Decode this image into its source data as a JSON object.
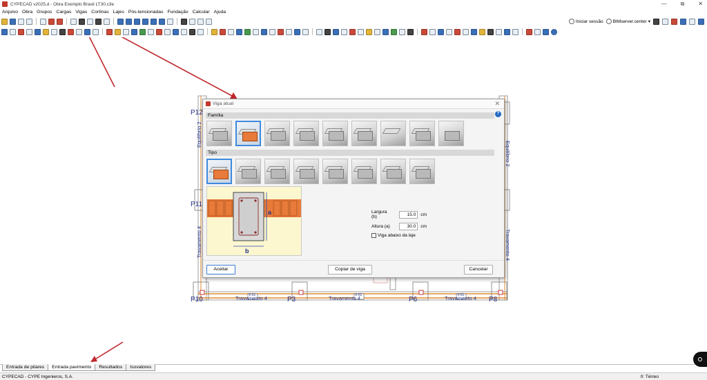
{
  "window": {
    "title": "CYPECAD v2025.d - Obra Exemplo Brasil LT30.c3e",
    "minimize": "—",
    "maximize": "⧉",
    "close": "✕"
  },
  "menu": [
    "Arquivo",
    "Obra",
    "Grupos",
    "Cargas",
    "Vigas",
    "Cortinas",
    "Lajes",
    "Pós-tensionadas",
    "Fundação",
    "Calcular",
    "Ajuda"
  ],
  "toolbar_right": {
    "login": "Iniciar sessão",
    "server": "BIMserver.center"
  },
  "drawing": {
    "columns": [
      "P12",
      "P11",
      "P10",
      "P3",
      "P6",
      "P8"
    ],
    "beams": {
      "left_top": "Equilíbrio 2",
      "left_mid": "Travamento 4",
      "right_top": "Equilíbrio 2",
      "right_mid": "Travamento 4",
      "bottom_left": "Travamento 4",
      "bottom_mid": "Travamento 4",
      "bottom_right": "Travamento 4"
    },
    "beam_tags": [
      "V-01",
      "V-01",
      "V-01"
    ],
    "colors": {
      "labels": "#1f2f8a",
      "beam_edge": "#e08a2a",
      "arrow": "#c0272d"
    }
  },
  "dialog": {
    "title": "Viga atual",
    "help": "?",
    "close": "✕",
    "family_label": "Família",
    "type_label": "Tipo",
    "family_count": 9,
    "type_count": 8,
    "preview_labels": {
      "height": "a",
      "width": "b"
    },
    "fields": {
      "width": {
        "label": "Largura (b)",
        "value": "15.0",
        "unit": "cm"
      },
      "height": {
        "label": "Altura (a)",
        "value": "30.0",
        "unit": "cm"
      }
    },
    "checkbox": "Viga abaixo da laje",
    "buttons": {
      "accept": "Aceitar",
      "copy": "Copiar de viga",
      "cancel": "Cancelar"
    }
  },
  "tabs": [
    "Entrada de pilares",
    "Entrada pavimento",
    "Resultados",
    "Isovalores"
  ],
  "active_tab": "Entrada pavimento",
  "status": {
    "left": "CYPECAD - CYPE Ingenieros, S.A.",
    "right": "0: Térreo"
  }
}
